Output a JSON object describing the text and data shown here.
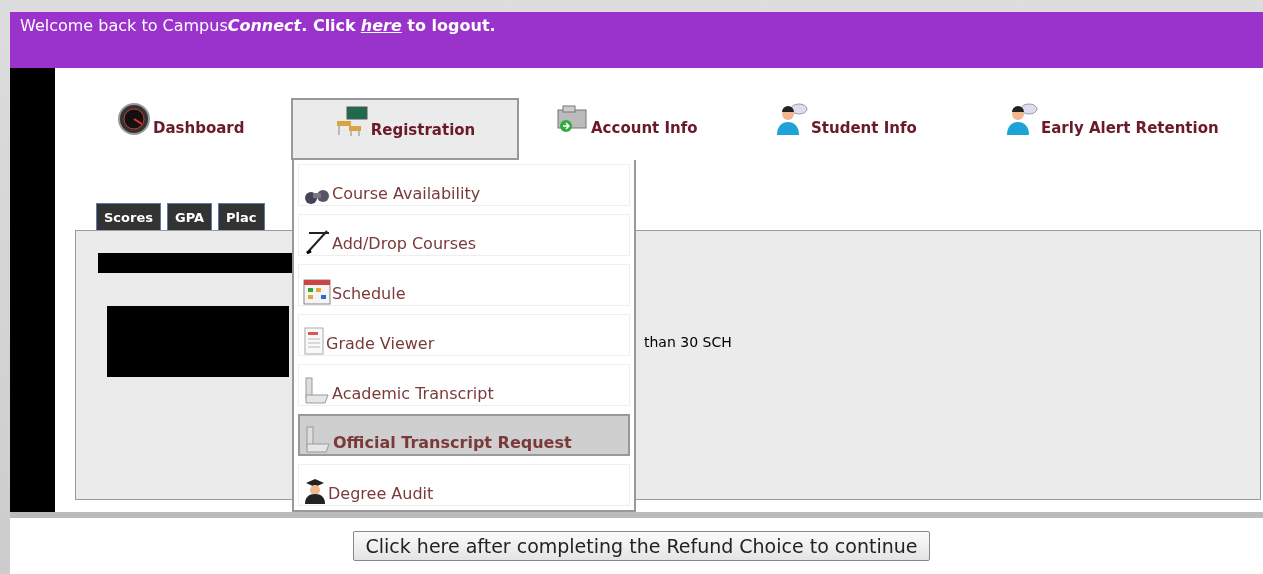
{
  "banner": {
    "text": "Welcome back to Campus",
    "brand": "Connect",
    "bold": ". Click",
    "link": "here",
    "suffix": " to logout."
  },
  "nav": [
    {
      "label": "Dashboard",
      "kind": "gauge",
      "selected": false
    },
    {
      "label": "Registration",
      "kind": "classroom",
      "selected": true
    },
    {
      "label": "Account Info",
      "kind": "building",
      "selected": false
    },
    {
      "label": "Student Info",
      "kind": "person",
      "selected": false
    },
    {
      "label": "Early Alert Retention",
      "kind": "person",
      "selected": false
    }
  ],
  "tabs": [
    {
      "label": "Scores"
    },
    {
      "label": "GPA"
    },
    {
      "label": "Plac"
    }
  ],
  "panel": {
    "visible_text": "than 30 SCH"
  },
  "menu": [
    {
      "label": "Course Availability",
      "kind": "binoculars",
      "selected": false
    },
    {
      "label": "Add/Drop Courses",
      "kind": "pen",
      "selected": false
    },
    {
      "label": "Schedule",
      "kind": "calendar",
      "selected": false
    },
    {
      "label": "Grade Viewer",
      "kind": "document",
      "selected": false
    },
    {
      "label": "Academic Transcript",
      "kind": "scanner",
      "selected": false
    },
    {
      "label": "Official Transcript Request",
      "kind": "scanner",
      "selected": true
    },
    {
      "label": "Degree Audit",
      "kind": "graduate",
      "selected": false
    }
  ],
  "continue_button": "Click here after completing the Refund Choice to continue"
}
